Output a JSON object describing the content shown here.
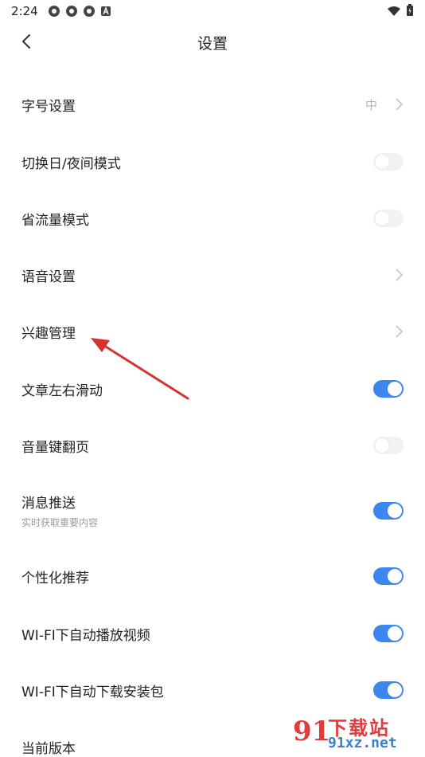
{
  "status_bar": {
    "time": "2:24"
  },
  "header": {
    "title": "设置"
  },
  "settings": [
    {
      "label": "字号设置",
      "value": "中",
      "control": "chevron"
    },
    {
      "label": "切换日/夜间模式",
      "control": "toggle",
      "on": false
    },
    {
      "label": "省流量模式",
      "control": "toggle",
      "on": false
    },
    {
      "label": "语音设置",
      "control": "chevron"
    },
    {
      "label": "兴趣管理",
      "control": "chevron"
    },
    {
      "label": "文章左右滑动",
      "control": "toggle",
      "on": true
    },
    {
      "label": "音量键翻页",
      "control": "toggle",
      "on": false
    },
    {
      "label": "消息推送",
      "sub": "实时获取重要内容",
      "control": "toggle",
      "on": true
    },
    {
      "label": "个性化推荐",
      "control": "toggle",
      "on": true
    },
    {
      "label": "WI-FI下自动播放视频",
      "control": "toggle",
      "on": true
    },
    {
      "label": "WI-FI下自动下载安装包",
      "control": "toggle",
      "on": true
    },
    {
      "label": "当前版本",
      "control": "none"
    }
  ],
  "watermark": {
    "logo": "91",
    "top": "下载站",
    "bottom": "91xz.net"
  },
  "colors": {
    "toggle_on": "#3d86f0",
    "toggle_off": "#f2f2f2",
    "arrow": "#d93030"
  }
}
